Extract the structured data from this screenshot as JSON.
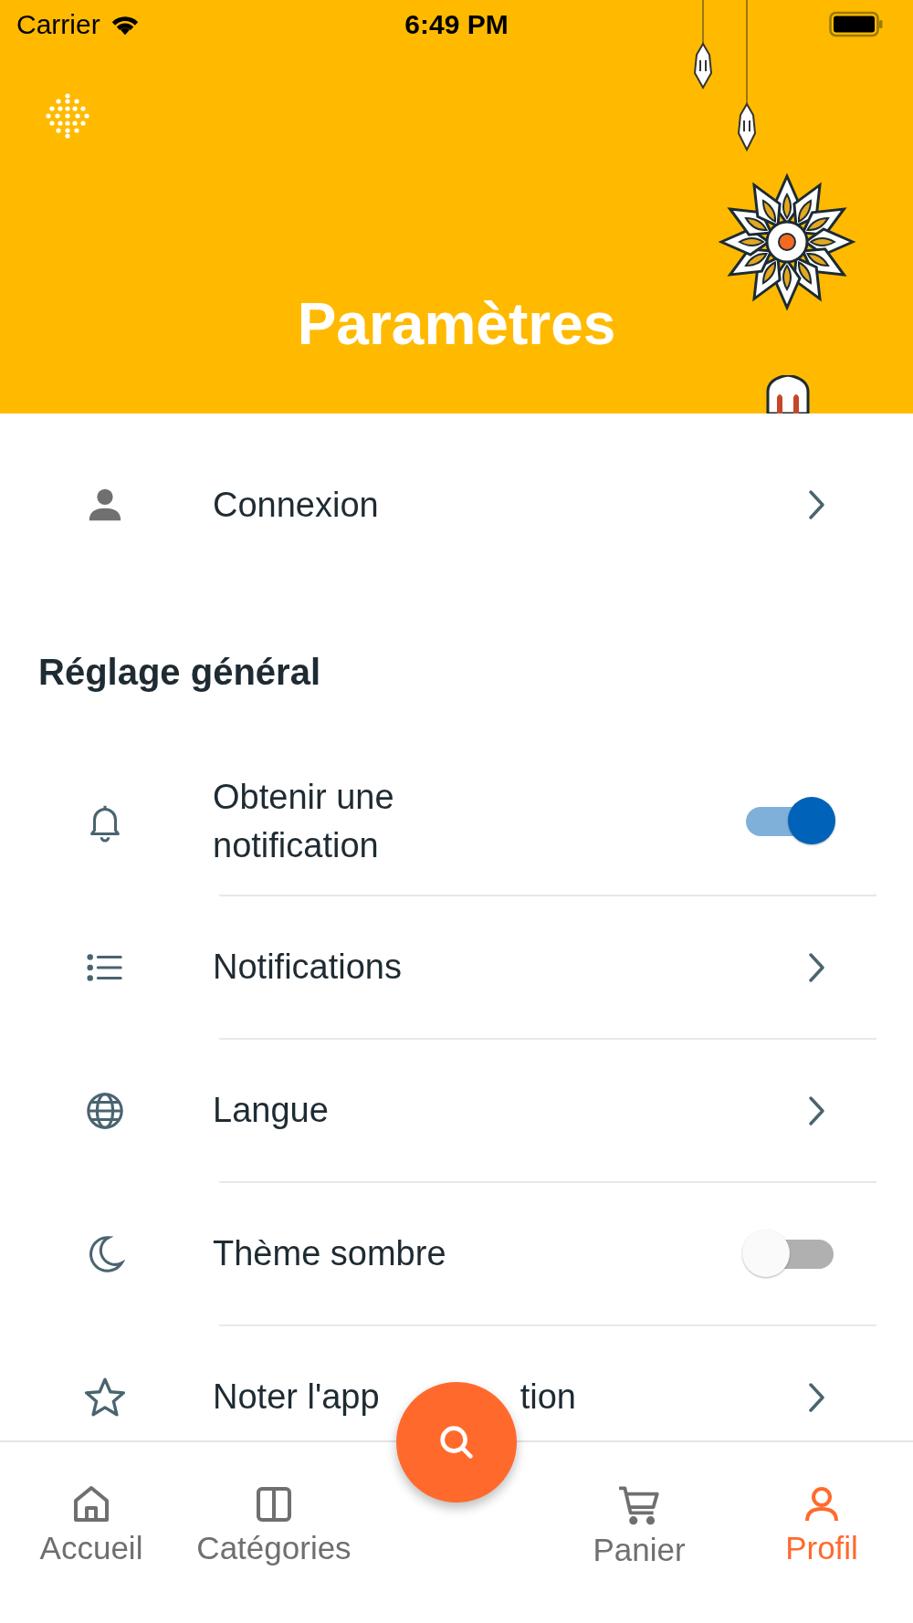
{
  "status_bar": {
    "carrier": "Carrier",
    "time": "6:49 PM"
  },
  "header": {
    "title": "Paramètres"
  },
  "account": {
    "label": "Connexion"
  },
  "section": {
    "title": "Réglage général"
  },
  "settings": [
    {
      "kind": "toggle",
      "label": "Obtenir une notification",
      "on": true
    },
    {
      "kind": "link",
      "label": "Notifications"
    },
    {
      "kind": "link",
      "label": "Langue"
    },
    {
      "kind": "toggle",
      "label": "Thème sombre",
      "on": false
    },
    {
      "kind": "link",
      "label_parts": [
        "Noter l'app",
        "tion"
      ]
    }
  ],
  "nav": [
    {
      "label": "Accueil",
      "selected": false
    },
    {
      "label": "Catégories",
      "selected": false
    },
    {
      "label": "Panier",
      "selected": false
    },
    {
      "label": "Profil",
      "selected": true
    }
  ]
}
